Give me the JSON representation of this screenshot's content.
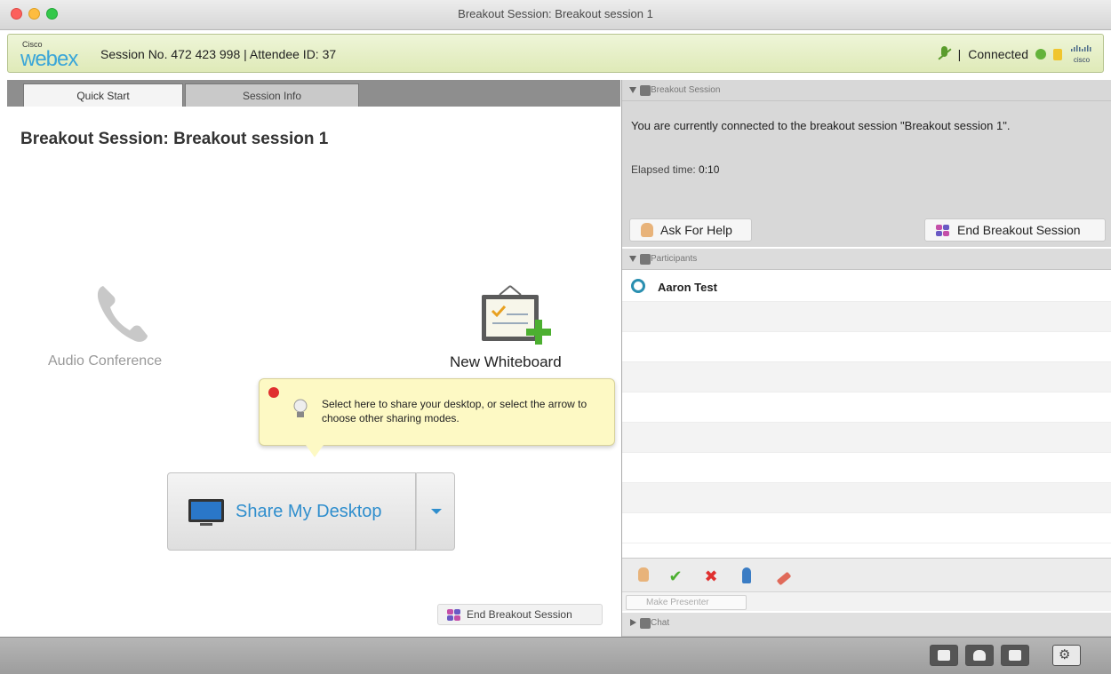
{
  "window": {
    "title": "Breakout Session: Breakout session 1"
  },
  "header": {
    "logo_small": "Cisco",
    "logo_main": "webex",
    "session_info": "Session No. 472 423 998 | Attendee ID: 37",
    "separator": "|",
    "status": "Connected",
    "cisco_logo": "cisco"
  },
  "tabs": [
    {
      "label": "Quick Start",
      "active": true
    },
    {
      "label": "Session Info",
      "active": false
    }
  ],
  "quick_start": {
    "title": "Breakout Session: Breakout session 1",
    "audio_label": "Audio Conference",
    "whiteboard_label": "New Whiteboard",
    "tooltip_text": "Select here to share your desktop, or select the arrow to choose other sharing modes.",
    "share_label": "Share My Desktop",
    "end_breakout_label": "End Breakout Session"
  },
  "breakout_panel": {
    "header": "Breakout Session",
    "message": "You are currently connected to the breakout session \"Breakout session 1\".",
    "elapsed_label": "Elapsed time:",
    "elapsed_value": "0:10",
    "ask_help_label": "Ask For Help",
    "end_label": "End Breakout Session"
  },
  "participants_panel": {
    "header": "Participants",
    "participants": [
      {
        "name": "Aaron Test"
      }
    ]
  },
  "toolbar": {
    "icons": [
      "raise-hand-icon",
      "check-icon",
      "x-icon",
      "pass-ball-icon",
      "eraser-icon"
    ],
    "check_glyph": "✔",
    "x_glyph": "✖",
    "presenter_placeholder": "Make Presenter"
  },
  "chat_panel": {
    "header": "Chat"
  },
  "colors": {
    "accent_blue": "#2f8ecd",
    "status_green": "#64b33b",
    "check_green": "#4caf30",
    "x_red": "#e0302f"
  }
}
